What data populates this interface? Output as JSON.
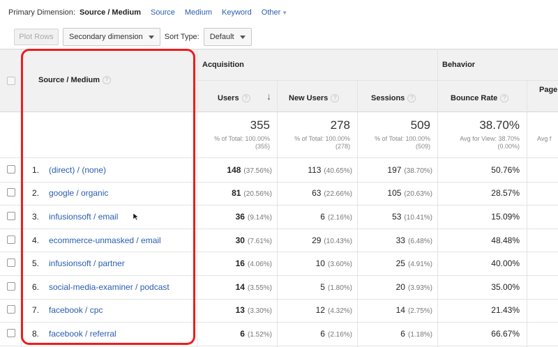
{
  "dimension_bar": {
    "label": "Primary Dimension:",
    "active": "Source / Medium",
    "links": [
      "Source",
      "Medium",
      "Keyword",
      "Other"
    ]
  },
  "toolbar": {
    "plot_rows": "Plot Rows",
    "secondary_dimension": "Secondary dimension",
    "sort_type_label": "Sort Type:",
    "sort_type_value": "Default"
  },
  "table": {
    "groups": {
      "acquisition": "Acquisition",
      "behavior": "Behavior"
    },
    "columns": {
      "source_medium": "Source / Medium",
      "users": "Users",
      "new_users": "New Users",
      "sessions": "Sessions",
      "bounce_rate": "Bounce Rate",
      "pages": "Page"
    },
    "totals": {
      "users": {
        "value": "355",
        "line1": "% of Total: 100.00%",
        "line2": "(355)"
      },
      "new_users": {
        "value": "278",
        "line1": "% of Total: 100.00%",
        "line2": "(278)"
      },
      "sessions": {
        "value": "509",
        "line1": "% of Total: 100.00%",
        "line2": "(509)"
      },
      "bounce_rate": {
        "value": "38.70%",
        "line1": "Avg for View: 38.70%",
        "line2": "(0.00%)"
      },
      "pages": {
        "line1": "Avg f"
      }
    },
    "rows": [
      {
        "num": "1.",
        "source": "(direct) / (none)",
        "users": "148",
        "users_pct": "(37.56%)",
        "new_users": "113",
        "new_users_pct": "(40.65%)",
        "sessions": "197",
        "sessions_pct": "(38.70%)",
        "bounce": "50.76%"
      },
      {
        "num": "2.",
        "source": "google / organic",
        "users": "81",
        "users_pct": "(20.56%)",
        "new_users": "63",
        "new_users_pct": "(22.66%)",
        "sessions": "105",
        "sessions_pct": "(20.63%)",
        "bounce": "28.57%"
      },
      {
        "num": "3.",
        "source": "infusionsoft / email",
        "users": "36",
        "users_pct": "(9.14%)",
        "new_users": "6",
        "new_users_pct": "(2.16%)",
        "sessions": "53",
        "sessions_pct": "(10.41%)",
        "bounce": "15.09%"
      },
      {
        "num": "4.",
        "source": "ecommerce-unmasked / email",
        "users": "30",
        "users_pct": "(7.61%)",
        "new_users": "29",
        "new_users_pct": "(10.43%)",
        "sessions": "33",
        "sessions_pct": "(6.48%)",
        "bounce": "48.48%"
      },
      {
        "num": "5.",
        "source": "infusionsoft / partner",
        "users": "16",
        "users_pct": "(4.06%)",
        "new_users": "10",
        "new_users_pct": "(3.60%)",
        "sessions": "25",
        "sessions_pct": "(4.91%)",
        "bounce": "40.00%"
      },
      {
        "num": "6.",
        "source": "social-media-examiner / podcast",
        "users": "14",
        "users_pct": "(3.55%)",
        "new_users": "5",
        "new_users_pct": "(1.80%)",
        "sessions": "20",
        "sessions_pct": "(3.93%)",
        "bounce": "35.00%"
      },
      {
        "num": "7.",
        "source": "facebook / cpc",
        "users": "13",
        "users_pct": "(3.30%)",
        "new_users": "12",
        "new_users_pct": "(4.32%)",
        "sessions": "14",
        "sessions_pct": "(2.75%)",
        "bounce": "21.43%"
      },
      {
        "num": "8.",
        "source": "facebook / referral",
        "users": "6",
        "users_pct": "(1.52%)",
        "new_users": "6",
        "new_users_pct": "(2.16%)",
        "sessions": "6",
        "sessions_pct": "(1.18%)",
        "bounce": "66.67%"
      }
    ]
  },
  "icons": {
    "help": "help-icon",
    "sort": "sort-down-arrow-icon",
    "cursor": "mouse-pointer-icon"
  },
  "colors": {
    "link": "#2a5db0",
    "highlight_box": "#ee1c1c",
    "header_bg": "#f1f1f1"
  }
}
